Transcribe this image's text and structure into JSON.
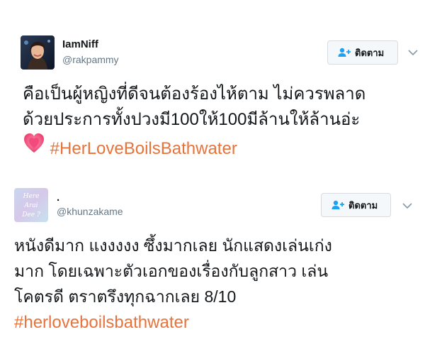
{
  "tweets": [
    {
      "name": "IamNiff",
      "handle": "@rakpammy",
      "follow_label": "ติดตาม",
      "lines": [
        "คือเป็นผู้หญิงที่ดีจนต้องร้องไห้ตาม  ไม่ควรพลาด",
        "ด้วยประการทั้งปวงมี100ให้100มีล้านให้ล้านอ่ะ"
      ],
      "hashtag": "#HerLoveBoilsBathwater",
      "emoji_icon": "sparkling-heart-icon"
    },
    {
      "name": ".",
      "handle": "@khunzakame",
      "follow_label": "ติดตาม",
      "avatar_text": [
        "Here",
        "Arai",
        "Dee ?"
      ],
      "lines": [
        "หนังดีมาก แงงงงง ซึ้งมากเลย นักแสดงเล่นเก่ง",
        "มาก โดยเฉพาะตัวเอกของเรื่องกับลูกสาว เล่น",
        "โคตรดี ตราตรึงทุกฉากเลย 8/10"
      ],
      "hashtag": "#herloveboilsbathwater"
    }
  ],
  "colors": {
    "hashtag": "#e8733a",
    "handle": "#657786",
    "follow_icon": "#1da1f2"
  }
}
